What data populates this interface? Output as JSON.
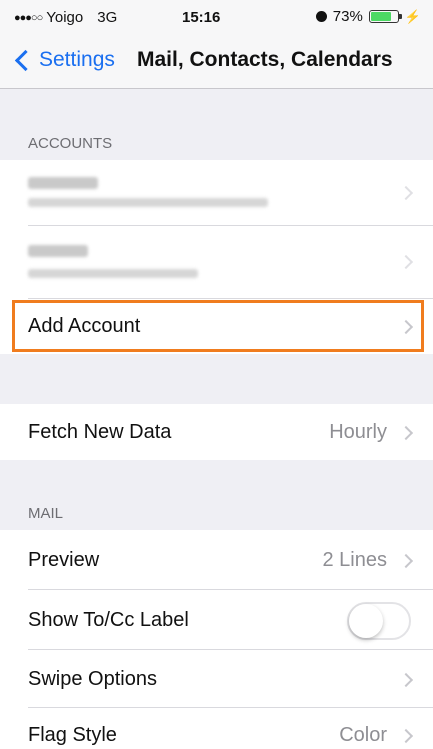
{
  "status_bar": {
    "carrier": "Yoigo",
    "network": "3G",
    "time": "15:16",
    "battery_percent": "73%",
    "battery_level": 0.73
  },
  "nav": {
    "back_label": "Settings",
    "title": "Mail, Contacts, Calendars"
  },
  "accounts_section": {
    "header": "ACCOUNTS",
    "add_account_label": "Add Account"
  },
  "fetch": {
    "label": "Fetch New Data",
    "value": "Hourly"
  },
  "mail_section": {
    "header": "MAIL",
    "rows": [
      {
        "label": "Preview",
        "value": "2 Lines"
      },
      {
        "label": "Show To/Cc Label",
        "value": ""
      },
      {
        "label": "Swipe Options",
        "value": ""
      },
      {
        "label": "Flag Style",
        "value": "Color"
      }
    ],
    "show_to_cc_enabled": false
  },
  "colors": {
    "accent": "#1a6ff0",
    "highlight": "#f07c1e",
    "battery": "#4cd964"
  }
}
